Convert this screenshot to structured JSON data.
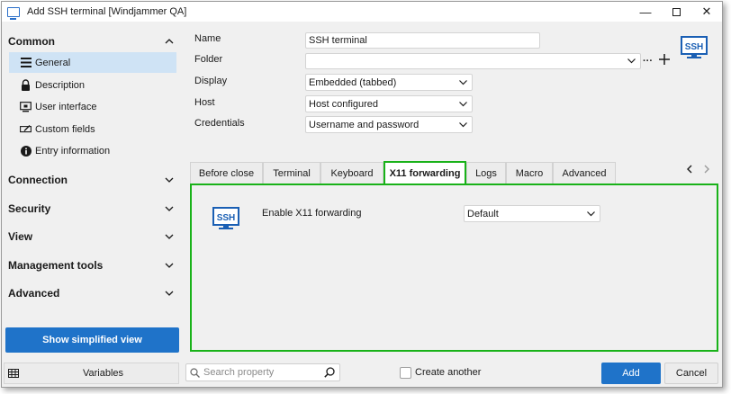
{
  "window": {
    "title": "Add SSH terminal [Windjammer QA]",
    "minimize_label": "—",
    "close_label": "✕"
  },
  "sidebar": {
    "common": {
      "label": "Common",
      "items": [
        {
          "label": "General",
          "icon": "list-icon"
        },
        {
          "label": "Description",
          "icon": "lock-icon"
        },
        {
          "label": "User interface",
          "icon": "monitor-icon"
        },
        {
          "label": "Custom fields",
          "icon": "edit-field-icon"
        },
        {
          "label": "Entry information",
          "icon": "info-icon"
        }
      ]
    },
    "sections": [
      "Connection",
      "Security",
      "View",
      "Management tools",
      "Advanced"
    ],
    "simplified_view_label": "Show simplified view"
  },
  "form": {
    "name_label": "Name",
    "name_value": "SSH terminal",
    "folder_label": "Folder",
    "folder_value": "",
    "display_label": "Display",
    "display_value": "Embedded (tabbed)",
    "host_label": "Host",
    "host_value": "Host configured",
    "credentials_label": "Credentials",
    "credentials_value": "Username and password"
  },
  "tabs": [
    "Before close",
    "Terminal",
    "Keyboard",
    "X11 forwarding",
    "Logs",
    "Macro",
    "Advanced"
  ],
  "active_tab": "X11 forwarding",
  "panel": {
    "enable_x11_label": "Enable X11 forwarding",
    "enable_x11_value": "Default"
  },
  "bottom": {
    "variables_label": "Variables",
    "search_placeholder": "Search property",
    "create_another_label": "Create another",
    "add_label": "Add",
    "cancel_label": "Cancel"
  },
  "colors": {
    "accent": "#1f73c9",
    "highlight": "#19b219",
    "selected_item": "#cfe3f5"
  },
  "icons": {
    "ssh": "ssh-icon",
    "ssh_glyph_text": "SSH"
  }
}
